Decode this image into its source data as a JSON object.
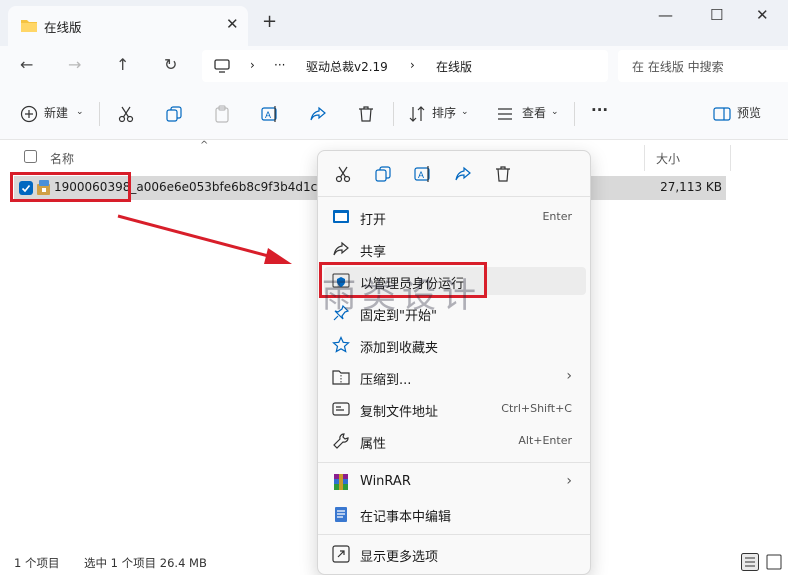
{
  "window": {
    "tab_title": "在线版",
    "close_tab": "✕",
    "new_tab": "+",
    "minimize": "—",
    "maximize": "☐",
    "close": "✕"
  },
  "address": {
    "more": "···",
    "separator": "›",
    "crumbs": [
      "驱动总裁v2.19",
      "在线版"
    ],
    "search_placeholder": "在 在线版 中搜索"
  },
  "toolbar": {
    "new_label": "新建",
    "sort_label": "排序",
    "view_label": "查看",
    "more_label": "···",
    "preview_label": "预览"
  },
  "columns": {
    "name": "名称",
    "size": "大小"
  },
  "files": [
    {
      "name_highlight": "1900060398",
      "name_rest": "_a006e6e053bfe6b8c9f3b4d1c6c1",
      "size": "27,113 KB"
    }
  ],
  "status": {
    "count": "1 个项目",
    "selected": "选中 1 个项目  26.4 MB"
  },
  "context_menu": {
    "items": [
      {
        "label": "打开",
        "shortcut": "Enter"
      },
      {
        "label": "共享",
        "shortcut": ""
      },
      {
        "label": "以管理员身份运行",
        "shortcut": ""
      },
      {
        "label": "固定到\"开始\"",
        "shortcut": ""
      },
      {
        "label": "添加到收藏夹",
        "shortcut": ""
      },
      {
        "label": "压缩到...",
        "shortcut": "›"
      },
      {
        "label": "复制文件地址",
        "shortcut": "Ctrl+Shift+C"
      },
      {
        "label": "属性",
        "shortcut": "Alt+Enter"
      },
      {
        "label": "WinRAR",
        "shortcut": "›"
      },
      {
        "label": "在记事本中编辑",
        "shortcut": ""
      },
      {
        "label": "显示更多选项",
        "shortcut": ""
      }
    ]
  },
  "watermark": "雨类设计",
  "colors": {
    "accent": "#0067c0",
    "highlight_box": "#d81e2a",
    "arrow": "#d81e2a"
  }
}
